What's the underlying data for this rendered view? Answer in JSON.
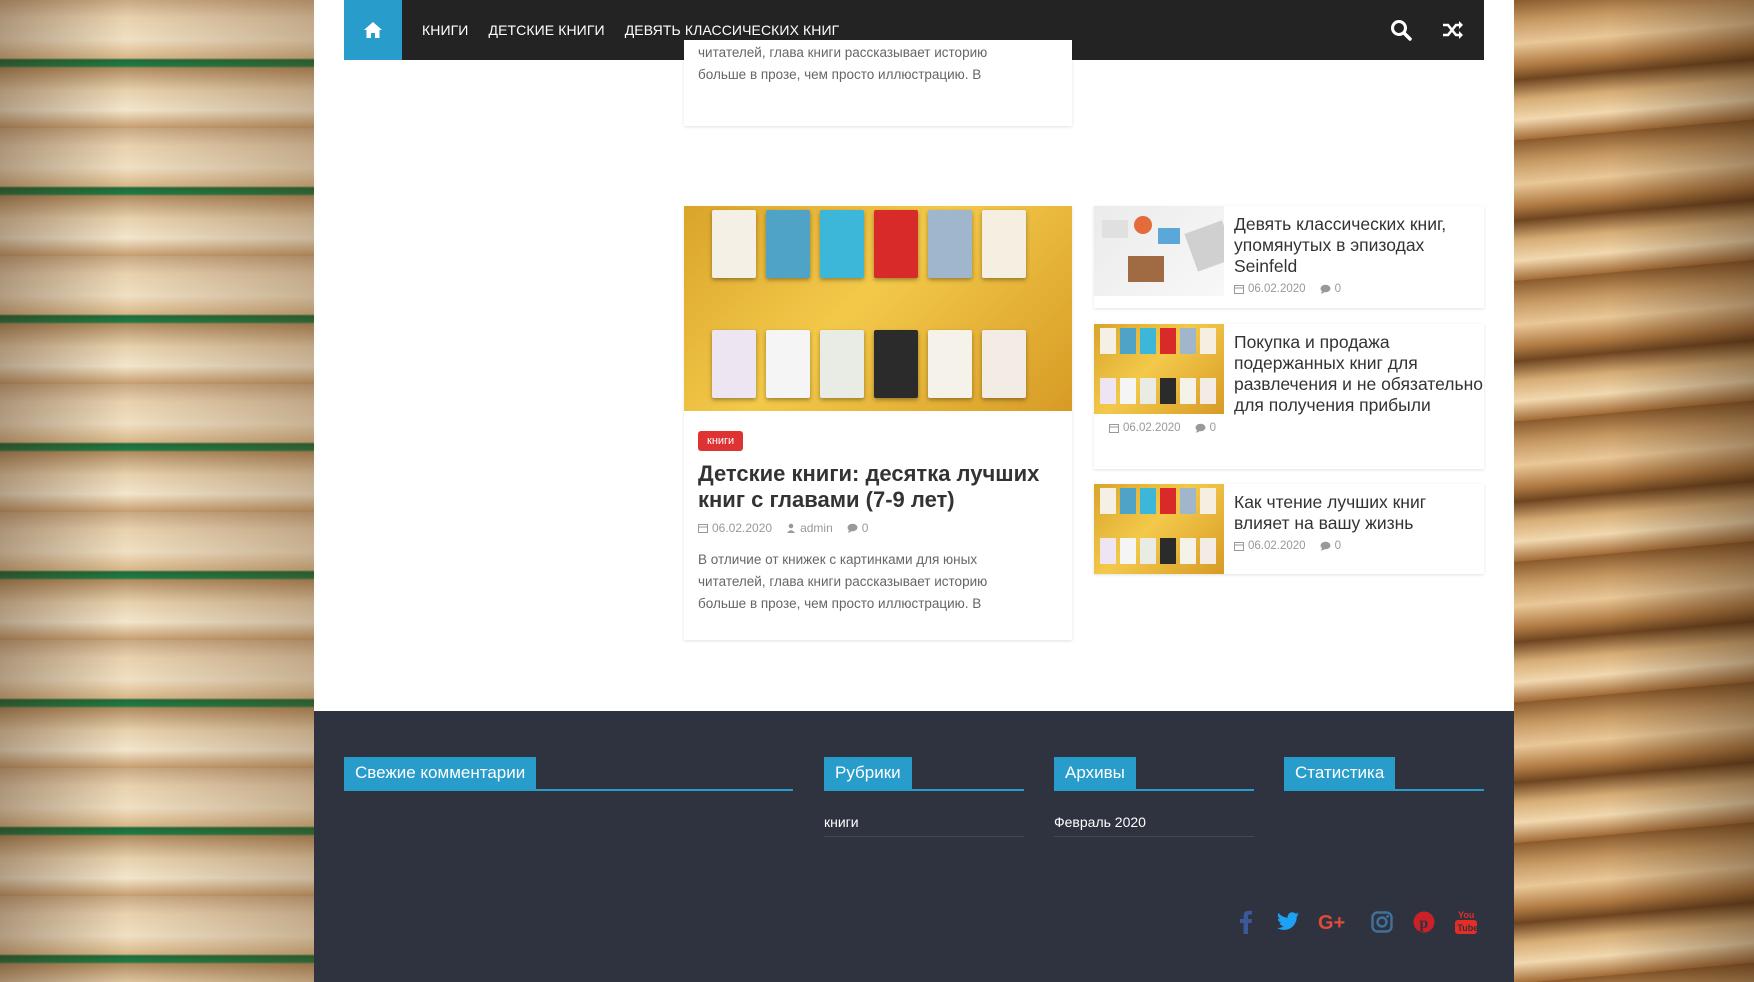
{
  "nav": {
    "items": [
      "КНИГИ",
      "ДЕТСКИЕ КНИГИ",
      "ДЕВЯТЬ КЛАССИЧЕСКИХ КНИГ"
    ]
  },
  "top_card": {
    "excerpt_line1": "читателей, глава книги рассказывает историю",
    "excerpt_line2": "больше в прозе, чем просто иллюстрацию. В"
  },
  "main_post": {
    "category": "книги",
    "title_line1": "Детские книги: десятка лучших",
    "title_line2": "книг с главами (7-9 лет)",
    "date": "06.02.2020",
    "author": "admin",
    "comments": "0",
    "excerpt_line1": "В отличие от книжек с картинками для юных",
    "excerpt_line2": "читателей, глава книги рассказывает историю",
    "excerpt_line3": "больше в прозе, чем просто иллюстрацию. В"
  },
  "side_posts": [
    {
      "title": "Девять классических книг, упомянутых в эпизодах Seinfeld",
      "date": "06.02.2020",
      "comments": "0"
    },
    {
      "title": "Покупка и продажа подержанных книг для развлечения и не обязательно для получения прибыли",
      "date": "06.02.2020",
      "comments": "0"
    },
    {
      "title": "Как чтение лучших книг влияет на вашу жизнь",
      "date": "06.02.2020",
      "comments": "0"
    }
  ],
  "footer": {
    "widgets": [
      {
        "title": "Свежие комментарии",
        "link": ""
      },
      {
        "title": "Рубрики",
        "link": "книги"
      },
      {
        "title": "Архивы",
        "link": "Февраль 2020"
      },
      {
        "title": "Статистика",
        "link": ""
      }
    ],
    "social_icons": [
      "facebook-icon",
      "twitter-icon",
      "google-plus-icon",
      "instagram-icon",
      "pinterest-icon",
      "youtube-icon"
    ]
  },
  "colors": {
    "accent": "#289dcc",
    "nav_bg": "#232323",
    "badge": "#dd3333",
    "footer_bg": "#2f3340"
  }
}
